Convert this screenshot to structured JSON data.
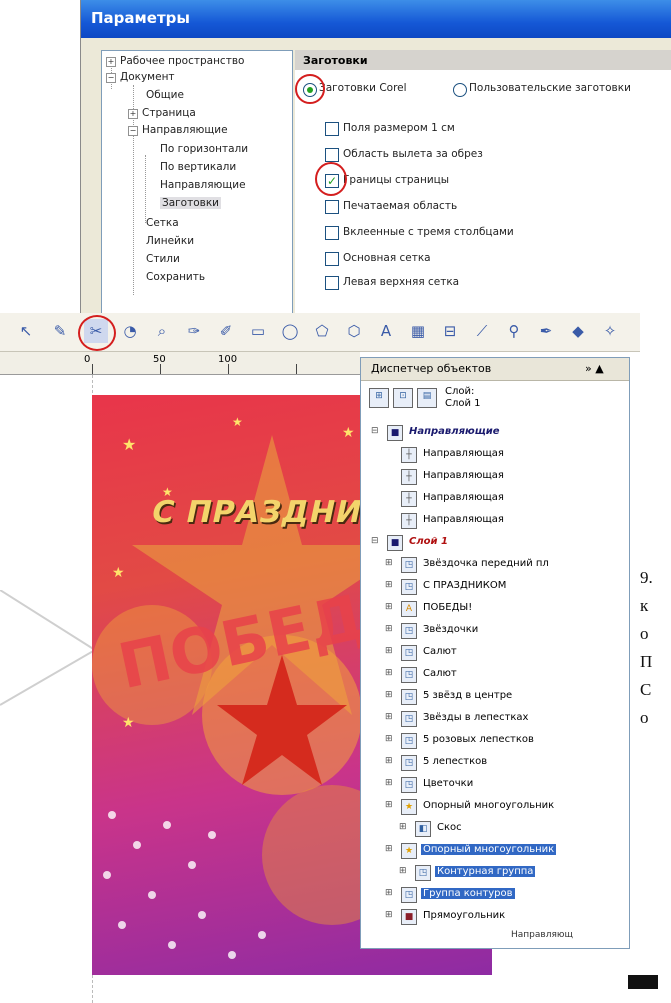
{
  "params": {
    "title": "Параметры",
    "tree": [
      "Рабочее пространство",
      "Документ",
      "Общие",
      "Страница",
      "Направляющие",
      "По горизонтали",
      "По вертикали",
      "Направляющие",
      "Заготовки",
      "Сетка",
      "Линейки",
      "Стили",
      "Сохранить"
    ],
    "tree_expanders": [
      "+",
      "−",
      "+",
      "−"
    ],
    "panel_header": "Заготовки",
    "radio_corel": "Заготовки Corel",
    "radio_user": "Пользовательские заготовки",
    "checkboxes": [
      {
        "label": "Поля размером 1 см",
        "checked": false
      },
      {
        "label": "Область вылета за обрез",
        "checked": false
      },
      {
        "label": "Границы страницы",
        "checked": true
      },
      {
        "label": "Печатаемая область",
        "checked": false
      },
      {
        "label": "Вклеенные с тремя столбцами",
        "checked": false
      },
      {
        "label": "Основная сетка",
        "checked": false
      },
      {
        "label": "Левая верхняя сетка",
        "checked": false
      }
    ],
    "check_mark": "✓"
  },
  "ruler": {
    "labels": [
      "0",
      "50",
      "100"
    ]
  },
  "poster": {
    "title": "С ПРАЗДНИ",
    "big": "ПОБЕД"
  },
  "objmgr": {
    "title": "Диспетчер объектов",
    "tab_glyphs": "»  ▲",
    "layer_line1": "Слой:",
    "layer_line2": "Слой 1",
    "items": [
      {
        "label": "Направляющие",
        "indent": 0,
        "type": "layer",
        "selected": false
      },
      {
        "label": "Направляющая",
        "indent": 1,
        "type": "guide",
        "selected": false
      },
      {
        "label": "Направляющая",
        "indent": 1,
        "type": "guide",
        "selected": false
      },
      {
        "label": "Направляющая",
        "indent": 1,
        "type": "guide",
        "selected": false
      },
      {
        "label": "Направляющая",
        "indent": 1,
        "type": "guide",
        "selected": false
      },
      {
        "label": "Слой 1",
        "indent": 0,
        "type": "layer",
        "selected": false
      },
      {
        "label": "Звёздочка передний пл",
        "indent": 1,
        "type": "group",
        "selected": false
      },
      {
        "label": "С ПРАЗДНИКОМ",
        "indent": 1,
        "type": "group",
        "selected": false
      },
      {
        "label": "ПОБЕДЫ!",
        "indent": 1,
        "type": "text",
        "selected": false
      },
      {
        "label": "Звёздочки",
        "indent": 1,
        "type": "group",
        "selected": false
      },
      {
        "label": "Салют",
        "indent": 1,
        "type": "group",
        "selected": false
      },
      {
        "label": "Салют",
        "indent": 1,
        "type": "group",
        "selected": false
      },
      {
        "label": "5 звёзд в центре",
        "indent": 1,
        "type": "group",
        "selected": false
      },
      {
        "label": "Звёзды в лепестках",
        "indent": 1,
        "type": "group",
        "selected": false
      },
      {
        "label": "5 розовых лепестков",
        "indent": 1,
        "type": "group",
        "selected": false
      },
      {
        "label": "5 лепестков",
        "indent": 1,
        "type": "group",
        "selected": false
      },
      {
        "label": "Цветочки",
        "indent": 1,
        "type": "group",
        "selected": false
      },
      {
        "label": "Опорный многоугольник",
        "indent": 1,
        "type": "star",
        "selected": false
      },
      {
        "label": "Скос",
        "indent": 2,
        "type": "effect",
        "selected": false
      },
      {
        "label": "Опорный многоугольник",
        "indent": 1,
        "type": "star",
        "selected": true
      },
      {
        "label": "Контурная группа",
        "indent": 2,
        "type": "group",
        "selected": true
      },
      {
        "label": "Группа контуров",
        "indent": 1,
        "type": "group",
        "selected": true
      },
      {
        "label": "Прямоугольник",
        "indent": 1,
        "type": "rect",
        "selected": false
      }
    ],
    "bottom_label": "Направляющ"
  },
  "side_text": [
    "9.",
    "к",
    "о",
    "П",
    "С",
    "о"
  ],
  "icons": [
    "pointer-icon",
    "shape-icon",
    "smart-fill-icon",
    "crop-icon",
    "zoom-icon",
    "freehand-icon",
    "smart-draw-icon",
    "rectangle-icon",
    "ellipse-icon",
    "polygon-icon",
    "basic-shapes-icon",
    "text-icon",
    "table-icon",
    "dimension-icon",
    "connector-icon",
    "eyedropper-icon",
    "outline-icon",
    "fill-icon",
    "interactive-fill-icon"
  ],
  "colors": {
    "accent": "#1558d6",
    "highlight": "#d41e1e",
    "selection": "#3168c4"
  }
}
